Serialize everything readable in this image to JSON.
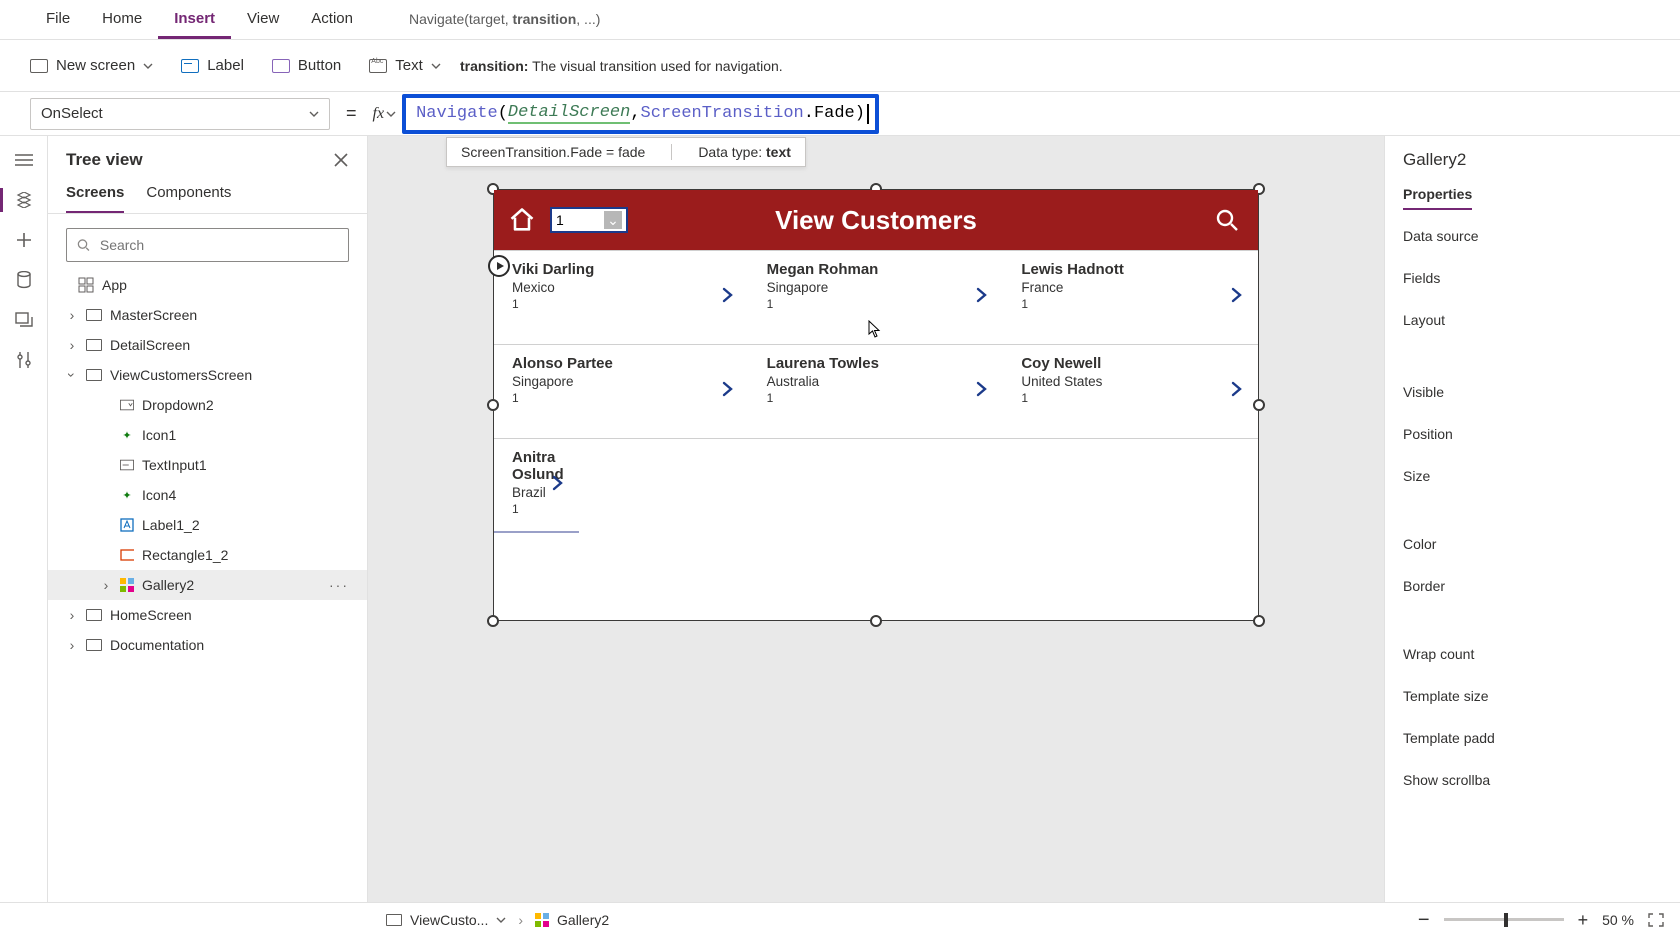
{
  "nav": {
    "tabs": [
      "File",
      "Home",
      "Insert",
      "View",
      "Action"
    ],
    "active": "Insert",
    "signatureHint": {
      "prefix": "Navigate(target, ",
      "bold": "transition",
      "suffix": ", ...)"
    }
  },
  "ribbon": {
    "newScreen": "New screen",
    "label": "Label",
    "button": "Button",
    "text": "Text",
    "tooltip": {
      "bold": "transition:",
      "rest": " The visual transition used for navigation."
    }
  },
  "formula": {
    "property": "OnSelect",
    "fn": "Navigate",
    "arg1": "DetailScreen",
    "arg2": "ScreenTransition",
    "arg2b": ".Fade",
    "resultLeft": "ScreenTransition.Fade  =  fade",
    "resultRightLabel": "Data type: ",
    "resultRightValue": "text"
  },
  "tree": {
    "title": "Tree view",
    "tabs": {
      "screens": "Screens",
      "components": "Components"
    },
    "searchPlaceholder": "Search",
    "appNode": "App",
    "nodes": [
      {
        "label": "MasterScreen",
        "kind": "screen",
        "expand": "closed"
      },
      {
        "label": "DetailScreen",
        "kind": "screen",
        "expand": "closed"
      },
      {
        "label": "ViewCustomersScreen",
        "kind": "screen",
        "expand": "open",
        "children": [
          {
            "label": "Dropdown2",
            "kind": "dropdown"
          },
          {
            "label": "Icon1",
            "kind": "icon"
          },
          {
            "label": "TextInput1",
            "kind": "textinput"
          },
          {
            "label": "Icon4",
            "kind": "icon"
          },
          {
            "label": "Label1_2",
            "kind": "label"
          },
          {
            "label": "Rectangle1_2",
            "kind": "rect"
          },
          {
            "label": "Gallery2",
            "kind": "gallery",
            "selected": true
          }
        ]
      },
      {
        "label": "HomeScreen",
        "kind": "screen",
        "expand": "closed"
      },
      {
        "label": "Documentation",
        "kind": "screen",
        "expand": "closed"
      }
    ]
  },
  "app": {
    "title": "View Customers",
    "dropdownValue": "1",
    "rows": [
      {
        "name": "Viki  Darling",
        "country": "Mexico",
        "num": "1"
      },
      {
        "name": "Megan  Rohman",
        "country": "Singapore",
        "num": "1"
      },
      {
        "name": "Lewis  Hadnott",
        "country": "France",
        "num": "1"
      },
      {
        "name": "Alonso  Partee",
        "country": "Singapore",
        "num": "1"
      },
      {
        "name": "Laurena  Towles",
        "country": "Australia",
        "num": "1"
      },
      {
        "name": "Coy  Newell",
        "country": "United States",
        "num": "1"
      },
      {
        "name": "Anitra  Oslund",
        "country": "Brazil",
        "num": "1"
      }
    ]
  },
  "props": {
    "control": "Gallery2",
    "tab": "Properties",
    "fields": [
      "Data source",
      "Fields",
      "Layout",
      "Visible",
      "Position",
      "Size",
      "Color",
      "Border",
      "Wrap count",
      "Template size",
      "Template padd",
      "Show scrollba"
    ]
  },
  "status": {
    "screenCrumb": "ViewCusto...",
    "controlCrumb": "Gallery2",
    "zoomValue": "50 %"
  }
}
